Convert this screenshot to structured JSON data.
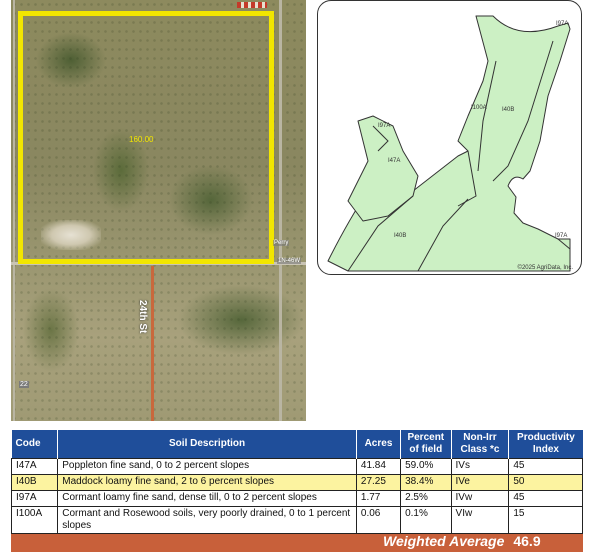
{
  "aerial": {
    "acres_label": "160.00",
    "street_label": "24th St",
    "twp_label": "1N-46W",
    "twp_label_2": "Perry",
    "county_road_label": "22"
  },
  "soil_map": {
    "labels": {
      "i97a_top": "I97A",
      "i47a": "I47A",
      "i40b_left": "I40B",
      "i100a": "I100A",
      "i40b_right": "I40B",
      "i97a_right": "I97A",
      "i97a_corner": "I97A"
    },
    "copyright": "©2025 AgriData, Inc.",
    "fill_color": "#ccf0c4",
    "line_color": "#333333"
  },
  "table": {
    "headers": {
      "code": "Code",
      "description": "Soil Description",
      "acres": "Acres",
      "percent": "Percent of field",
      "class": "Non-Irr Class *c",
      "index": "Productivity Index"
    },
    "rows": [
      {
        "code": "I47A",
        "description": "Poppleton fine sand, 0 to 2 percent slopes",
        "acres": "41.84",
        "percent": "59.0%",
        "class": "IVs",
        "index": "45"
      },
      {
        "code": "I40B",
        "description": "Maddock loamy fine sand, 2 to 6 percent slopes",
        "acres": "27.25",
        "percent": "38.4%",
        "class": "IVe",
        "index": "50"
      },
      {
        "code": "I97A",
        "description": "Cormant loamy fine sand, dense till, 0 to 2 percent slopes",
        "acres": "1.77",
        "percent": "2.5%",
        "class": "IVw",
        "index": "45"
      },
      {
        "code": "I100A",
        "description": "Cormant and Rosewood soils, very poorly drained, 0 to 1 percent slopes",
        "acres": "0.06",
        "percent": "0.1%",
        "class": "VIw",
        "index": "15"
      }
    ],
    "weighted_average_label": "Weighted Average",
    "weighted_average_value": "46.9",
    "header_color": "#1f4e9a",
    "highlight_color": "#fcf3a0",
    "footer_color": "#c8603a"
  }
}
